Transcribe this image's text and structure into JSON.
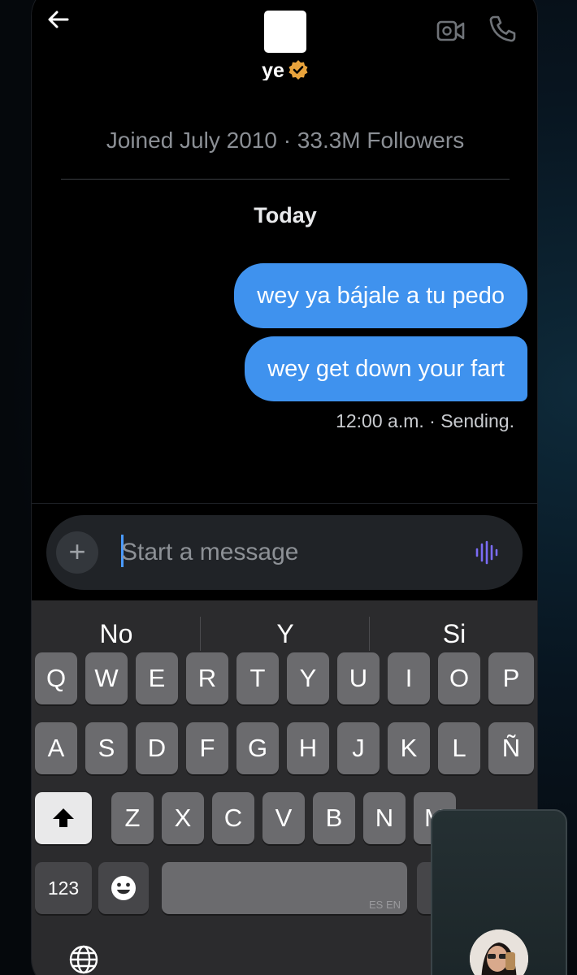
{
  "header": {
    "username": "ye",
    "verified_color": "#e8a33c",
    "back_icon": "arrow-left-icon",
    "video_icon": "video-call-icon",
    "call_icon": "phone-icon"
  },
  "chat": {
    "profile_meta": "Joined July 2010 · 33.3M Followers",
    "day_label": "Today",
    "messages": [
      {
        "text": "wey ya bájale a tu pedo",
        "from": "me"
      },
      {
        "text": "wey get down your fart",
        "from": "me"
      }
    ],
    "status": "12:00 a.m. · Sending."
  },
  "compose": {
    "placeholder": "Start a message",
    "value": "",
    "plus_label": "+",
    "voice_icon": "voice-wave-icon",
    "voice_color": "#7b6cf6"
  },
  "keyboard": {
    "suggestions": [
      "No",
      "Y",
      "Si"
    ],
    "row1": [
      "Q",
      "W",
      "E",
      "R",
      "T",
      "Y",
      "U",
      "I",
      "O",
      "P"
    ],
    "row2": [
      "A",
      "S",
      "D",
      "F",
      "G",
      "H",
      "J",
      "K",
      "L",
      "Ñ"
    ],
    "row3": [
      "Z",
      "X",
      "C",
      "V",
      "B",
      "N",
      "M"
    ],
    "numbers_label": "123",
    "emoji_icon": "emoji-icon",
    "shift_icon": "shift-icon",
    "globe_icon": "globe-icon",
    "space_lang": "ES EN"
  },
  "colors": {
    "bubble": "#3f92ee",
    "accent": "#4a9bff"
  }
}
